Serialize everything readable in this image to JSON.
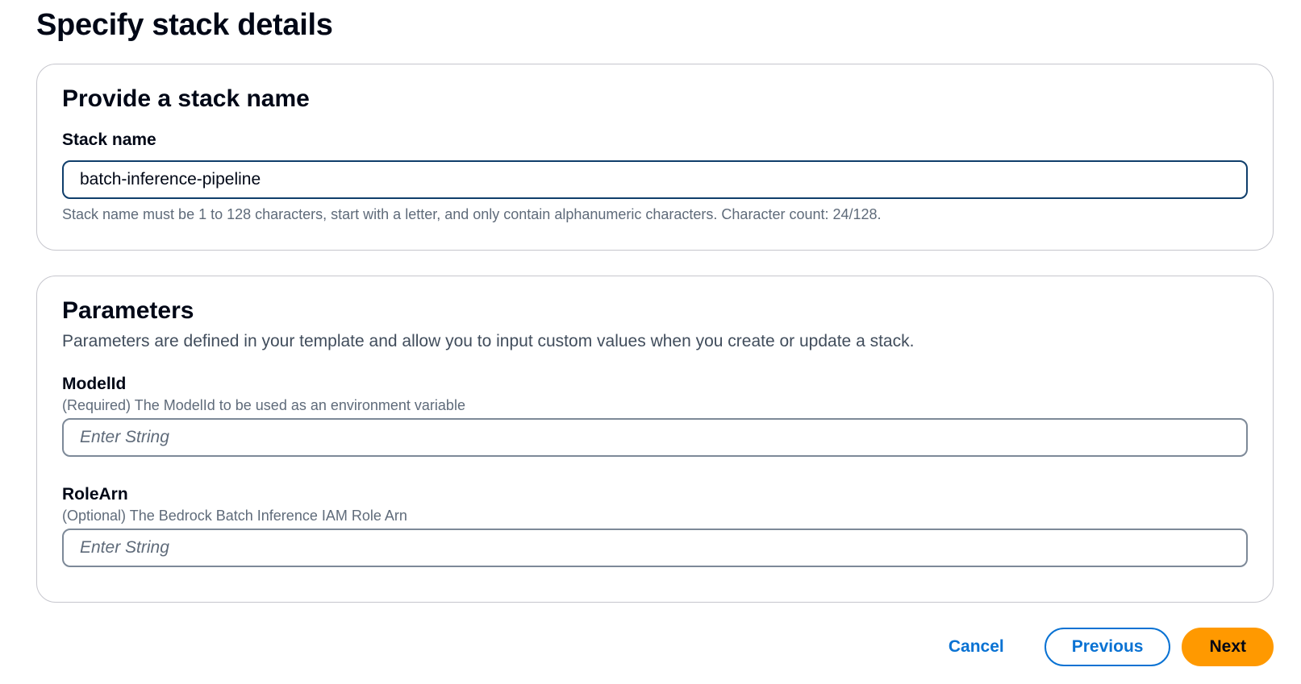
{
  "page": {
    "title": "Specify stack details"
  },
  "stack_section": {
    "title": "Provide a stack name",
    "field_label": "Stack name",
    "value": "batch-inference-pipeline",
    "constraint_text": "Stack name must be 1 to 128 characters, start with a letter, and only contain alphanumeric characters. Character count: 24/128."
  },
  "parameters_section": {
    "title": "Parameters",
    "description": "Parameters are defined in your template and allow you to input custom values when you create or update a stack.",
    "fields": [
      {
        "label": "ModelId",
        "description": "(Required) The ModelId to be used as an environment variable",
        "placeholder": "Enter String",
        "value": ""
      },
      {
        "label": "RoleArn",
        "description": "(Optional) The Bedrock Batch Inference IAM Role Arn",
        "placeholder": "Enter String",
        "value": ""
      }
    ]
  },
  "actions": {
    "cancel_label": "Cancel",
    "previous_label": "Previous",
    "next_label": "Next"
  },
  "colors": {
    "primary_button": "#ff9900",
    "link_blue": "#0972d3",
    "focused_input_border": "#0f3e6b"
  }
}
